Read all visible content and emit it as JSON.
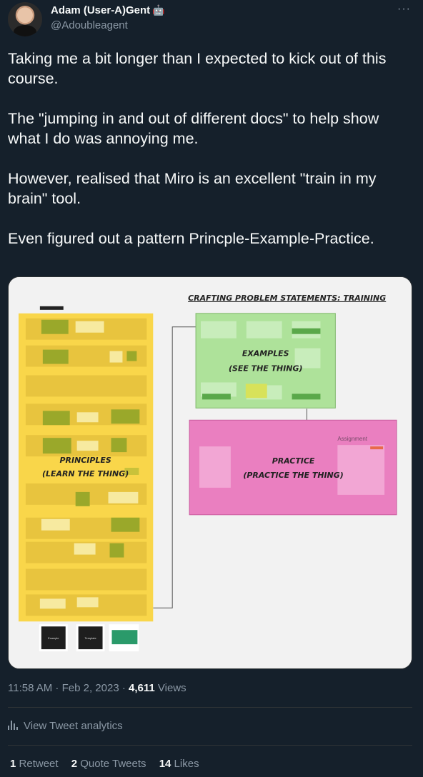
{
  "author": {
    "name": "Adam (User-A)Gent",
    "emoji": "🤖",
    "handle": "@Adoubleagent"
  },
  "menu_glyph": "···",
  "tweet": {
    "text": "Taking me a bit longer than I expected to kick out of this course.\n\nThe \"jumping in and out of different docs\" to help show what I do was annoying me.\n\nHowever, realised that Miro is an excellent \"train in my brain\" tool.\n\nEven figured out a pattern Princple-Example-Practice."
  },
  "board": {
    "title": "CRAFTING PROBLEM STATEMENTS: TRAINING",
    "principles_line1": "PRINCIPLES",
    "principles_line2": "(LEARN THE THING)",
    "examples_line1": "EXAMPLES",
    "examples_line2": "(SEE THE THING)",
    "practice_line1": "PRACTICE",
    "practice_line2": "(PRACTICE THE THING)",
    "assignment_label": "Assignment",
    "bottom_cards": [
      "Example",
      "Template",
      ""
    ],
    "colors": {
      "principles": "#f9d64a",
      "examples": "#aee29a",
      "practice": "#ea7fc0",
      "canvas": "#f2f2f2"
    }
  },
  "meta": {
    "time": "11:58 AM",
    "separator": " · ",
    "date": "Feb 2, 2023",
    "views_count": "4,611",
    "views_label": " Views"
  },
  "analytics": {
    "label": "View Tweet analytics"
  },
  "stats": {
    "retweets_count": "1",
    "retweets_label": "Retweet",
    "quotes_count": "2",
    "quotes_label": "Quote Tweets",
    "likes_count": "14",
    "likes_label": "Likes"
  }
}
